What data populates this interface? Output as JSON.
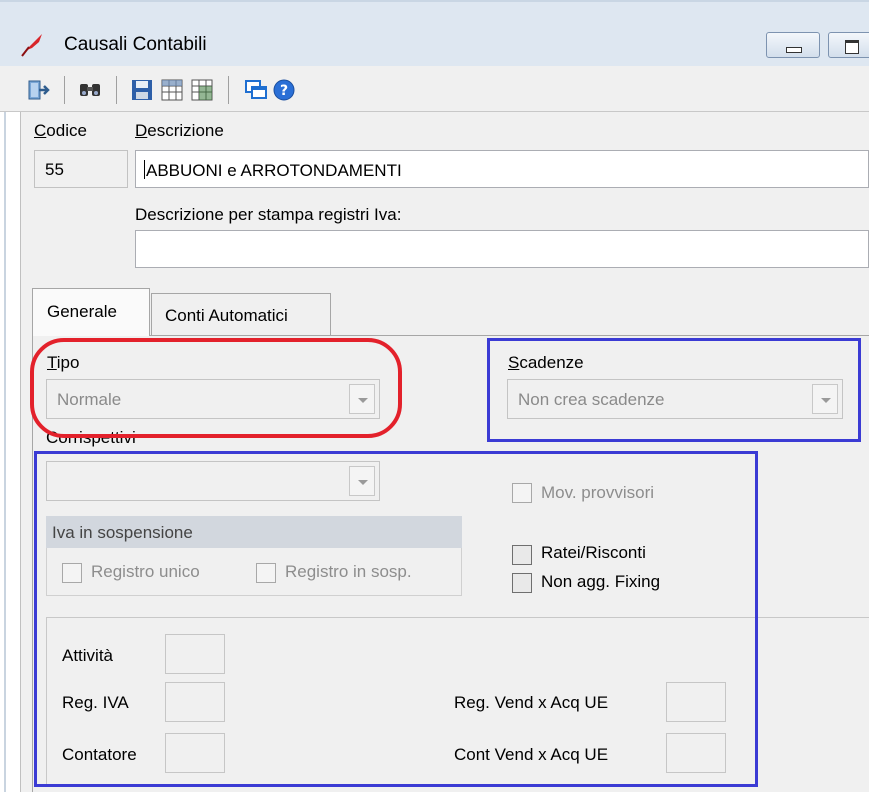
{
  "window": {
    "title": "Causali Contabili"
  },
  "toolbar": {
    "icons": [
      "exit-icon",
      "find-icon",
      "save-icon",
      "grid-icon",
      "grid-alt-icon",
      "windows-icon",
      "help-icon"
    ]
  },
  "header_fields": {
    "codice_label": "Codice",
    "codice_value": "55",
    "descrizione_label": "Descrizione",
    "descrizione_value": "ABBUONI e ARROTONDAMENTI",
    "descr_stampa_label": "Descrizione per stampa registri Iva:",
    "descr_stampa_value": ""
  },
  "tabs": [
    {
      "label": "Generale",
      "active": true
    },
    {
      "label": "Conti Automatici",
      "active": false
    }
  ],
  "generale": {
    "tipo_label": "Tipo",
    "tipo_value": "Normale",
    "scadenze_label": "Scadenze",
    "scadenze_value": "Non crea scadenze",
    "corrispettivi_label": "Corrispettivi",
    "corrispettivi_value": "",
    "mov_provvisori_label": "Mov. provvisori",
    "iva_sospensione_title": "Iva in sospensione",
    "registro_unico_label": "Registro unico",
    "registro_sosp_label": "Registro in sosp.",
    "ratei_risconti_label": "Ratei/Risconti",
    "non_agg_fixing_label": "Non agg. Fixing",
    "attivita_label": "Attività",
    "reg_iva_label": "Reg. IVA",
    "contatore_label": "Contatore",
    "reg_vend_acq_label": "Reg. Vend x Acq UE",
    "cont_vend_acq_label": "Cont Vend x Acq UE"
  },
  "colors": {
    "annotation_red": "#e3212b",
    "annotation_blue": "#3b3bd4",
    "form_bg": "#f0f0f0"
  }
}
